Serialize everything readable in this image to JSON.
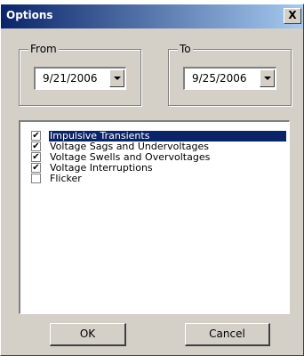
{
  "window": {
    "title": "Options",
    "close_glyph": "X"
  },
  "from": {
    "label": "From",
    "date": "9/21/2006"
  },
  "to": {
    "label": "To",
    "date": "9/25/2006"
  },
  "list": {
    "items": [
      {
        "label": "Impulsive Transients",
        "checked": true,
        "selected": true
      },
      {
        "label": "Voltage Sags and Undervoltages",
        "checked": true,
        "selected": false
      },
      {
        "label": "Voltage Swells and Overvoltages",
        "checked": true,
        "selected": false
      },
      {
        "label": "Voltage Interruptions",
        "checked": true,
        "selected": false
      },
      {
        "label": "Flicker",
        "checked": false,
        "selected": false
      }
    ],
    "check_glyph": "✔"
  },
  "buttons": {
    "ok": "OK",
    "cancel": "Cancel"
  },
  "colors": {
    "titlebar": "#0a246a",
    "face": "#d4d0c8",
    "selection": "#0a246a"
  }
}
